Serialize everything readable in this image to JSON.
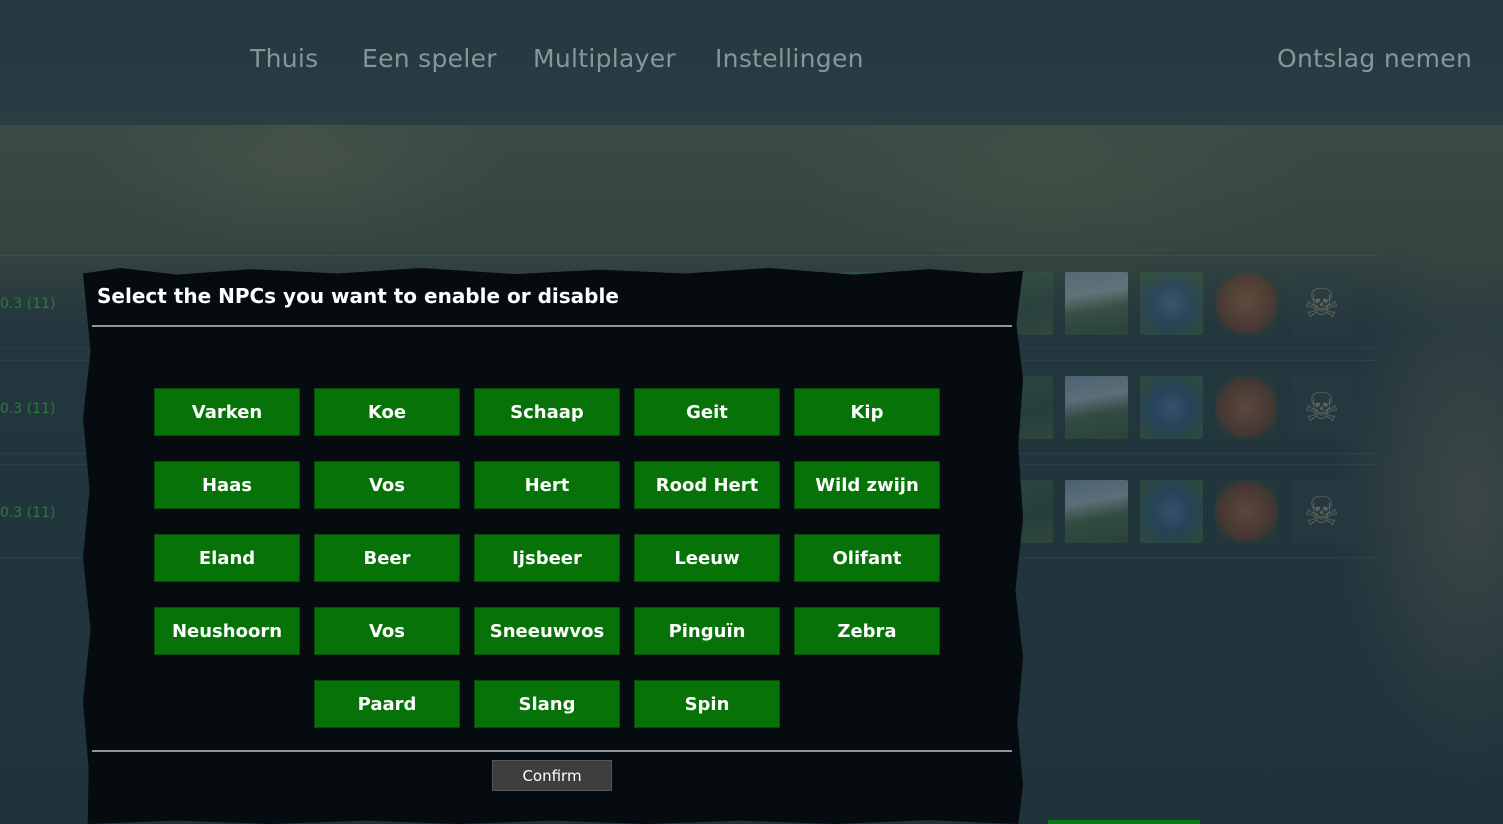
{
  "nav": {
    "home": "Thuis",
    "singleplayer": "Een speler",
    "multiplayer": "Multiplayer",
    "settings": "Instellingen",
    "quit": "Ontslag nemen"
  },
  "worlds": [
    {
      "version": "0.3 (11)"
    },
    {
      "version": "0.3 (11)"
    },
    {
      "version": "0.3 (11)"
    }
  ],
  "modal": {
    "title": "Select the NPCs you want to enable or disable",
    "npcs": [
      "Varken",
      "Koe",
      "Schaap",
      "Geit",
      "Kip",
      "Haas",
      "Vos",
      "Hert",
      "Rood Hert",
      "Wild zwijn",
      "Eland",
      "Beer",
      "Ijsbeer",
      "Leeuw",
      "Olifant",
      "Neushoorn",
      "Vos",
      "Sneeuwvos",
      "Pinguïn",
      "Zebra",
      "Paard",
      "Slang",
      "Spin"
    ],
    "confirm_label": "Confirm"
  },
  "colors": {
    "npc_enabled": "#067207",
    "modal_bg": "#060b10",
    "nav_text": "#8a9599"
  },
  "icons": {
    "skull": "skull-icon"
  }
}
